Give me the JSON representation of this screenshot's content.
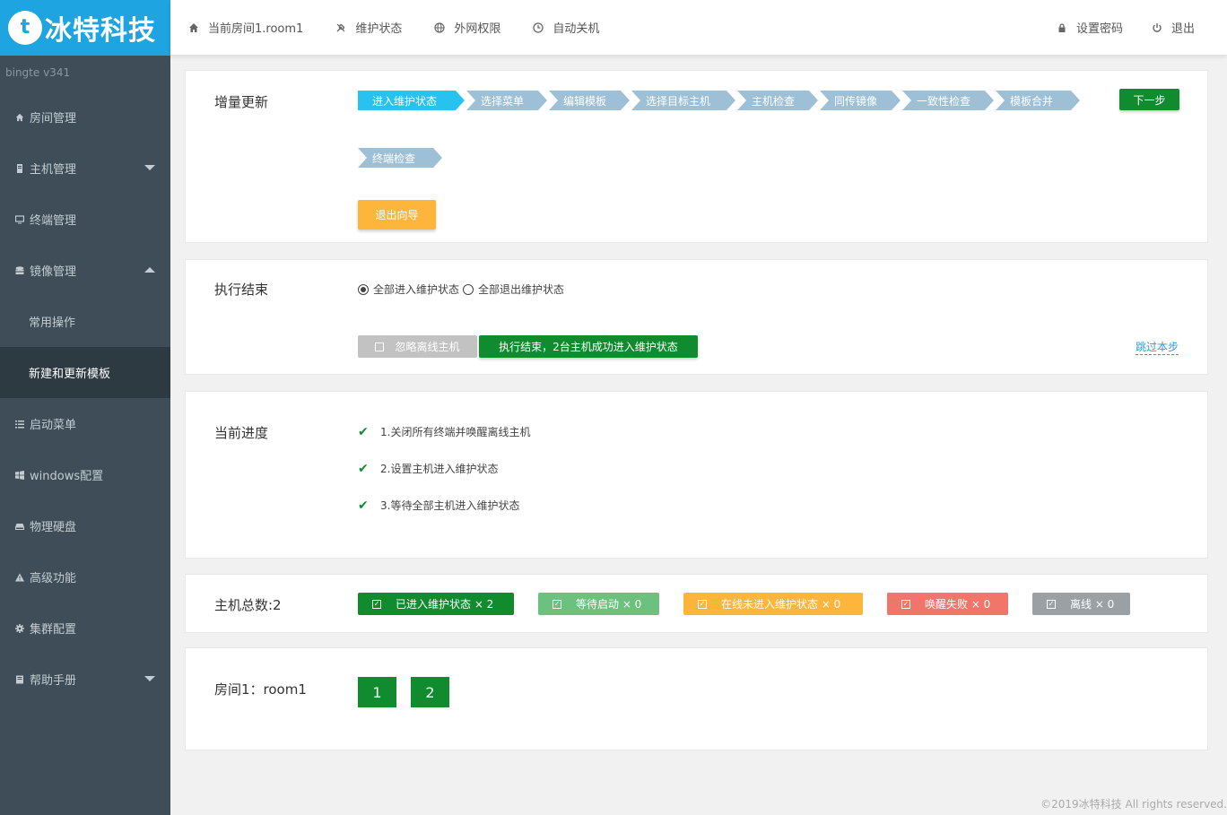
{
  "brand": {
    "logo_letter": "t",
    "name": "冰特科技"
  },
  "version": "bingte  v341",
  "topnav": {
    "left": [
      {
        "icon": "home-icon",
        "label": "当前房间1.room1"
      },
      {
        "icon": "wrench-icon",
        "label": "维护状态"
      },
      {
        "icon": "globe-icon",
        "label": "外网权限"
      },
      {
        "icon": "clock-icon",
        "label": "自动关机"
      }
    ],
    "right": [
      {
        "icon": "lock-icon",
        "label": "设置密码"
      },
      {
        "icon": "power-icon",
        "label": "退出"
      }
    ]
  },
  "sidebar": {
    "items": [
      {
        "icon": "home-icon",
        "label": "房间管理"
      },
      {
        "icon": "server-icon",
        "label": "主机管理"
      },
      {
        "icon": "monitor-icon",
        "label": "终端管理"
      },
      {
        "icon": "database-icon",
        "label": "镜像管理"
      },
      {
        "label": "常用操作"
      },
      {
        "label": "新建和更新模板"
      },
      {
        "icon": "list-icon",
        "label": "启动菜单"
      },
      {
        "icon": "windows-icon",
        "label": "windows配置"
      },
      {
        "icon": "hdd-icon",
        "label": "物理硬盘"
      },
      {
        "icon": "warning-icon",
        "label": "高级功能"
      },
      {
        "icon": "cog-icon",
        "label": "集群配置"
      },
      {
        "icon": "book-icon",
        "label": "帮助手册"
      }
    ]
  },
  "wizard": {
    "title": "增量更新",
    "steps": [
      "进入维护状态",
      "选择菜单",
      "编辑模板",
      "选择目标主机",
      "主机检查",
      "同传镜像",
      "一致性检查",
      "模板合并",
      "终端检查"
    ],
    "active_step": 0,
    "next_label": "下一步",
    "exit_label": "退出向导"
  },
  "exec": {
    "title": "执行结束",
    "radio1": "全部进入维护状态",
    "radio2": "全部退出维护状态",
    "ignore_label": "忽略离线主机",
    "result_label": "执行结束，2台主机成功进入维护状态",
    "skip_label": "跳过本步"
  },
  "progress": {
    "title": "当前进度",
    "items": [
      "1.关闭所有终端并唤醒离线主机",
      "2.设置主机进入维护状态",
      "3.等待全部主机进入维护状态"
    ]
  },
  "hosts": {
    "title": "主机总数:2",
    "badges": [
      {
        "label": "已进入维护状态 × 2",
        "color": "#108c2f"
      },
      {
        "label": "等待启动 × 0",
        "color": "#6cc17e"
      },
      {
        "label": "在线未进入维护状态 × 0",
        "color": "#fdb53c"
      },
      {
        "label": "唤醒失败 × 0",
        "color": "#f2756a"
      },
      {
        "label": "离线 × 0",
        "color": "#9aa0a4"
      }
    ]
  },
  "room": {
    "title": "房间1：room1",
    "hosts": [
      "1",
      "2"
    ]
  },
  "footer": "©2019冰特科技 All rights reserved."
}
